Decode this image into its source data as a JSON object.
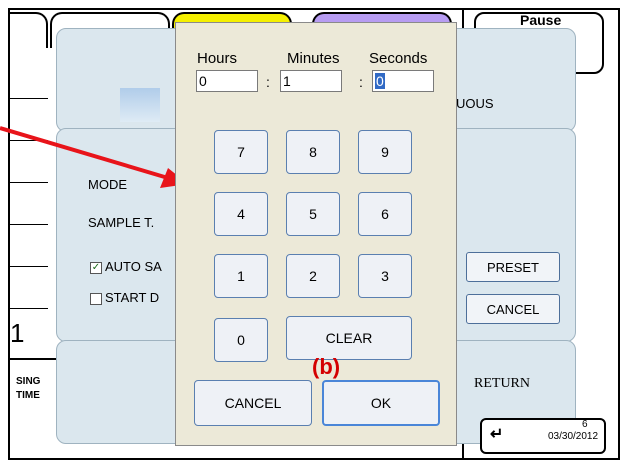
{
  "background": {
    "pause_label": "Pause",
    "continuous_label": "UOUS",
    "mode_label": "MODE",
    "sample_label": "SAMPLE T.",
    "auto_label": "AUTO SA",
    "auto_checked": true,
    "start_label": "START D",
    "start_checked": false,
    "preset_button": "PRESET",
    "cancel_button": "CANCEL",
    "return_label": "RETURN",
    "big_number": "1",
    "sing_label": "SING",
    "time_label": "TIME",
    "date_text": "03/30/2012",
    "date_partial": "6"
  },
  "keypad": {
    "hours_label": "Hours",
    "minutes_label": "Minutes",
    "seconds_label": "Seconds",
    "hours_value": "0",
    "minutes_value": "1",
    "seconds_value": "0",
    "colon": ":",
    "keys": [
      "7",
      "8",
      "9",
      "4",
      "5",
      "6",
      "1",
      "2",
      "3",
      "0"
    ],
    "clear_label": "CLEAR",
    "cancel_label": "CANCEL",
    "ok_label": "OK"
  },
  "annotation": {
    "label": "(b)",
    "color": "#d40000"
  }
}
